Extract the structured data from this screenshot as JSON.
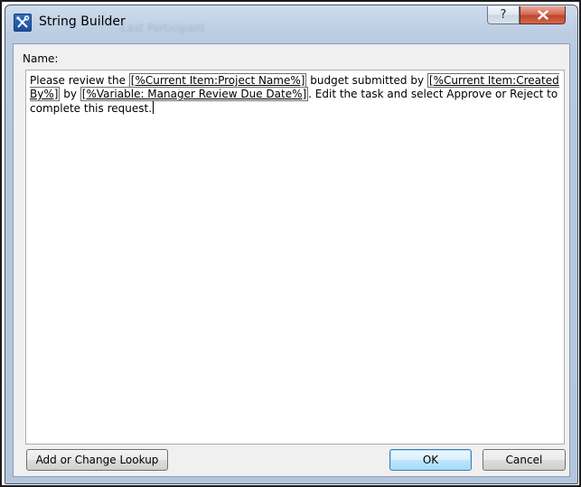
{
  "window": {
    "title": "String Builder",
    "background_ghost_text": "Last Participant",
    "help_symbol": "?",
    "icon": "tools-icon"
  },
  "form": {
    "name_label": "Name:",
    "text_segments": [
      {
        "type": "text",
        "text": "Please review the "
      },
      {
        "type": "lookup",
        "text": "[%Current Item:Project Name%]"
      },
      {
        "type": "text",
        "text": " budget submitted by "
      },
      {
        "type": "lookup",
        "text": "[%Current Item:Created By%]"
      },
      {
        "type": "text",
        "text": " by "
      },
      {
        "type": "lookup",
        "text": "[%Variable: Manager Review Due Date%]"
      },
      {
        "type": "text",
        "text": ". Edit the task and select Approve or Reject to complete this request."
      }
    ]
  },
  "buttons": {
    "lookup_label": "Add or Change Lookup",
    "ok_label": "OK",
    "cancel_label": "Cancel"
  },
  "colors": {
    "titlebar": "#bccde3",
    "close_button": "#c1452b",
    "ok_border": "#3c7fb1"
  }
}
